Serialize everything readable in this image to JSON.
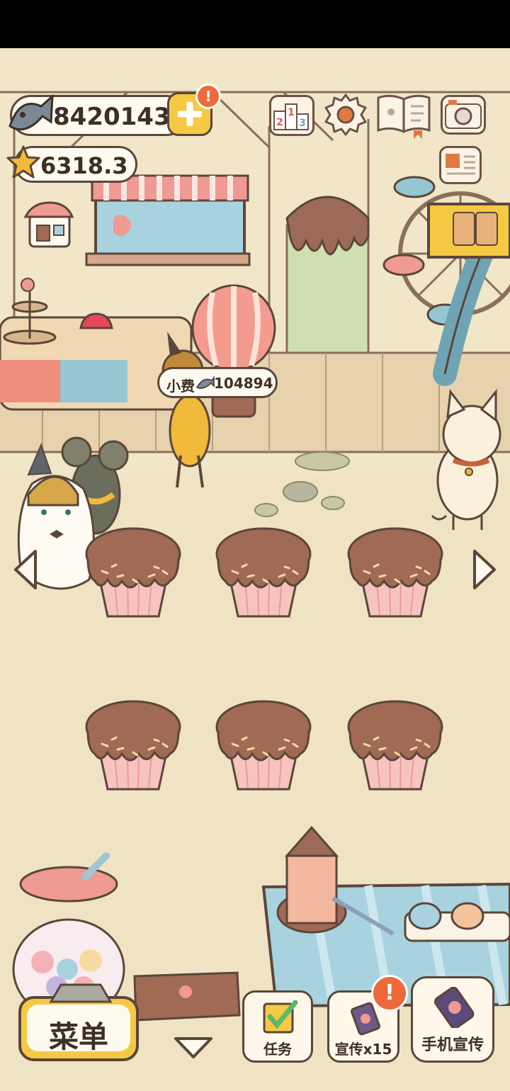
{
  "currency": {
    "fish_count": "8420143",
    "star_count": "6318.3"
  },
  "tip_bubble": {
    "label": "小费",
    "amount": "104894"
  },
  "ranking_icon_digits": {
    "first": "1",
    "second": "2",
    "third": "3"
  },
  "bottom_bar": {
    "menu_label": "菜单",
    "task_label": "任务",
    "promo_label": "宣传x15",
    "phone_promo_label": "手机宣传"
  },
  "badges": {
    "alert_symbol": "!"
  },
  "icons": {
    "fish": "fish-icon",
    "star": "star-icon",
    "add": "plus-icon",
    "ranking": "ranking-icon",
    "settings": "gear-icon",
    "recipe_book": "book-icon",
    "camera": "camera-icon",
    "shop": "shop-icon",
    "newspaper": "newspaper-icon",
    "nav_left": "chevron-left-icon",
    "nav_right": "chevron-right-icon",
    "collapse": "chevron-down-icon"
  },
  "colors": {
    "background": "#efe3c4",
    "outline": "#5b463a",
    "accent_yellow": "#f6c945",
    "alert_orange": "#ec6a3a",
    "chocolate": "#a06a55",
    "cupcake_liner": "#f6c3c0"
  }
}
